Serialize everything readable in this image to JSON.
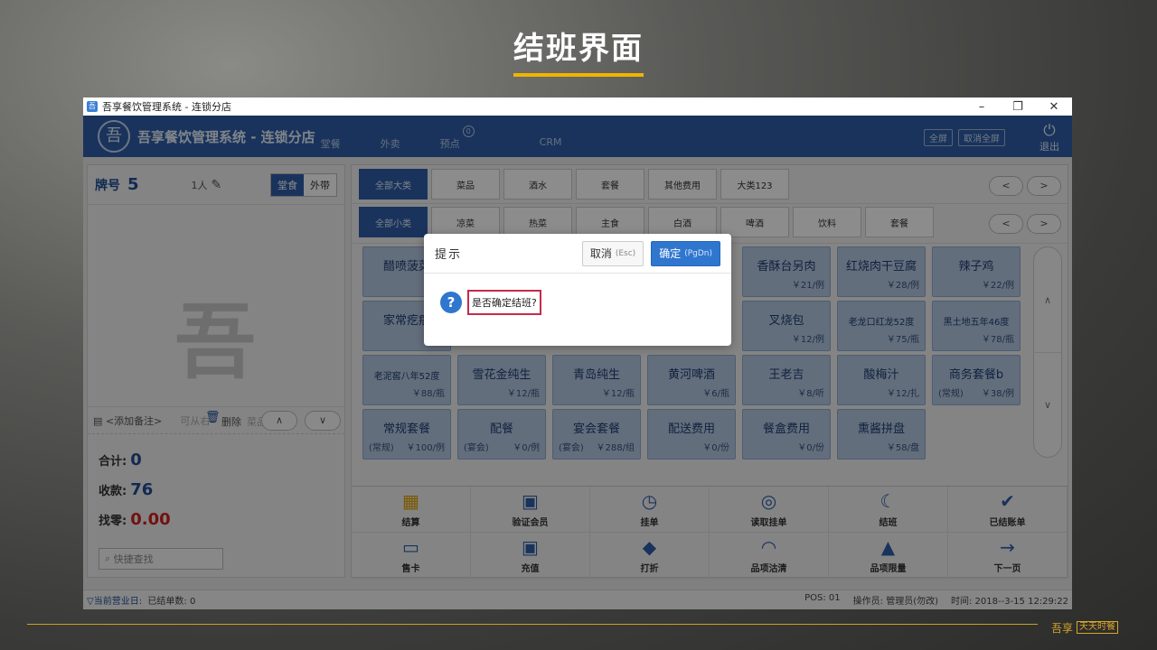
{
  "slide": {
    "title": "结班界面"
  },
  "brand": {
    "corner_a": "吾享",
    "corner_b": "天天时餐"
  },
  "window": {
    "title": "吾享餐饮管理系统 - 连锁分店",
    "btn_min": "–",
    "btn_restore": "❐",
    "btn_close": "✕"
  },
  "header": {
    "app_title": "吾享餐饮管理系统 - 连锁分店",
    "nav": [
      "堂餐",
      "外卖",
      "预点",
      "CRM"
    ],
    "preorder_count": "0",
    "fullscreen": "全屏",
    "cancel_fullscreen": "取消全屏",
    "exit": "退出"
  },
  "left": {
    "table_label": "牌号",
    "table_no": "5",
    "people": "1人",
    "mode_dine": "堂食",
    "mode_takeout": "外带",
    "add_note": "<添加备注>",
    "hint_ghost": "可从右",
    "delete_label": "删除",
    "ghost_tail": "菜品",
    "up": "∧",
    "down": "∨",
    "total_label": "合计:",
    "total": "0",
    "received_label": "收款:",
    "received": "76",
    "change_label": "找零:",
    "change": "0.00",
    "search_placeholder": "快捷查找"
  },
  "categories_big": [
    "全部大类",
    "菜品",
    "酒水",
    "套餐",
    "其他费用",
    "大类123"
  ],
  "categories_small": [
    "全部小类",
    "凉菜",
    "热菜",
    "主食",
    "白酒",
    "啤酒",
    "饮料",
    "套餐"
  ],
  "pager": {
    "prev": "<",
    "next": ">"
  },
  "items": [
    {
      "name": "醋喷菠菜",
      "tag": "",
      "price": "￥2"
    },
    {
      "name": "香酥台另肉",
      "tag": "",
      "price": "￥21/例"
    },
    {
      "name": "红烧肉干豆腐",
      "tag": "",
      "price": "￥28/例"
    },
    {
      "name": "辣子鸡",
      "tag": "",
      "price": "￥22/例"
    },
    {
      "name": "家常疙瘩",
      "tag": "",
      "price": "￥1"
    },
    {
      "name": "叉烧包",
      "tag": "",
      "price": "￥12/例"
    },
    {
      "name": "老龙口红龙52度",
      "tag": "",
      "price": "￥75/瓶"
    },
    {
      "name": "黑土地五年46度",
      "tag": "",
      "price": "￥78/瓶"
    },
    {
      "name": "老泥窖八年52度",
      "tag": "",
      "price": "￥88/瓶"
    },
    {
      "name": "雪花金纯生",
      "tag": "",
      "price": "￥12/瓶"
    },
    {
      "name": "青岛纯生",
      "tag": "",
      "price": "￥12/瓶"
    },
    {
      "name": "黄河啤酒",
      "tag": "",
      "price": "￥6/瓶"
    },
    {
      "name": "王老吉",
      "tag": "",
      "price": "￥8/听"
    },
    {
      "name": "酸梅汁",
      "tag": "",
      "price": "￥12/扎"
    },
    {
      "name": "商务套餐b",
      "tag": "(常规)",
      "price": "￥38/例"
    },
    {
      "name": "常规套餐",
      "tag": "(常规)",
      "price": "￥100/例"
    },
    {
      "name": "配餐",
      "tag": "(宴会)",
      "price": "￥0/例"
    },
    {
      "name": "宴会套餐",
      "tag": "(宴会)",
      "price": "￥288/组"
    },
    {
      "name": "配送费用",
      "tag": "",
      "price": "￥0/份"
    },
    {
      "name": "餐盒费用",
      "tag": "",
      "price": "￥0/份"
    },
    {
      "name": "熏酱拼盘",
      "tag": "",
      "price": "￥58/盘"
    }
  ],
  "scroll": {
    "up": "∧",
    "down": "∨"
  },
  "actions": [
    {
      "icon": "calculator-icon",
      "glyph": "▦",
      "label": "结算"
    },
    {
      "icon": "member-card-icon",
      "glyph": "▣",
      "label": "验证会员"
    },
    {
      "icon": "clock-icon",
      "glyph": "◷",
      "label": "挂单"
    },
    {
      "icon": "search-doc-icon",
      "glyph": "◎",
      "label": "读取挂单"
    },
    {
      "icon": "moon-icon",
      "glyph": "☾",
      "label": "结班"
    },
    {
      "icon": "clipboard-check-icon",
      "glyph": "✔",
      "label": "已结账单"
    },
    {
      "icon": "card-icon",
      "glyph": "▭",
      "label": "售卡"
    },
    {
      "icon": "recharge-icon",
      "glyph": "▣",
      "label": "充值"
    },
    {
      "icon": "tag-icon",
      "glyph": "◆",
      "label": "打折"
    },
    {
      "icon": "cloche-icon",
      "glyph": "◠",
      "label": "品项沽清"
    },
    {
      "icon": "helmet-icon",
      "glyph": "▲",
      "label": "品项限量"
    },
    {
      "icon": "arrow-right-icon",
      "glyph": "→",
      "label": "下一页"
    }
  ],
  "status": {
    "biz_day": "▽当前营业日:",
    "settled": "已结单数: 0",
    "pos": "POS: 01",
    "operator": "操作员: 管理员(勿改)",
    "time": "时间: 2018--3-15 12:29:22"
  },
  "dialog": {
    "title": "提示",
    "cancel": "取消",
    "cancel_key": "(Esc)",
    "ok": "确定",
    "ok_key": "(PgDn)",
    "message": "是否确定结班?",
    "icon": "?"
  },
  "colors": {
    "brand_blue": "#2e5ea8",
    "accent_gold": "#f0b400",
    "alert_red": "#d02020",
    "dialog_ok": "#2f76cf"
  }
}
